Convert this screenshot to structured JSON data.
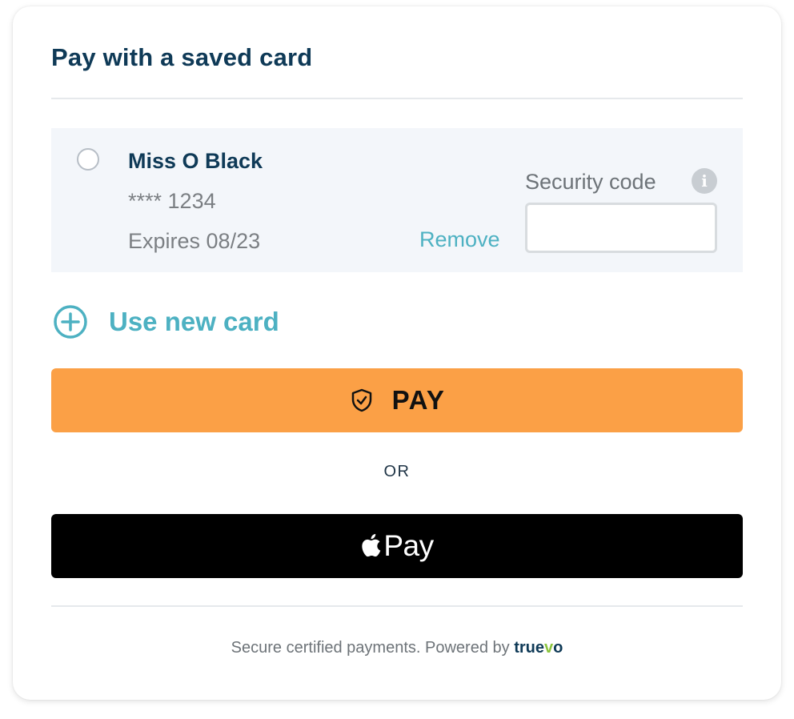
{
  "title": "Pay with a saved card",
  "saved_card": {
    "holder_name": "Miss O Black",
    "masked_number": "**** 1234",
    "expiry": "Expires 08/23",
    "remove_label": "Remove",
    "security_code_label": "Security code",
    "security_code_value": "",
    "selected": false
  },
  "new_card_label": "Use new card",
  "pay_button_label": "PAY",
  "or_label": "OR",
  "apple_pay_label": "Pay",
  "footer": {
    "text": "Secure certified payments. Powered by",
    "brand_before": "true",
    "brand_accent": "v",
    "brand_after": "o"
  },
  "icons": {
    "radio": "radio-unchecked",
    "info": "info-icon",
    "add": "plus-circle-icon",
    "pay": "shield-check-icon",
    "apple": "apple-logo-icon"
  },
  "colors": {
    "title": "#0f3a57",
    "accent": "#4db1c2",
    "pay_button": "#fba046",
    "apple_button": "#000000",
    "card_background": "#f3f6fa",
    "brand_accent": "#8cc43e"
  }
}
